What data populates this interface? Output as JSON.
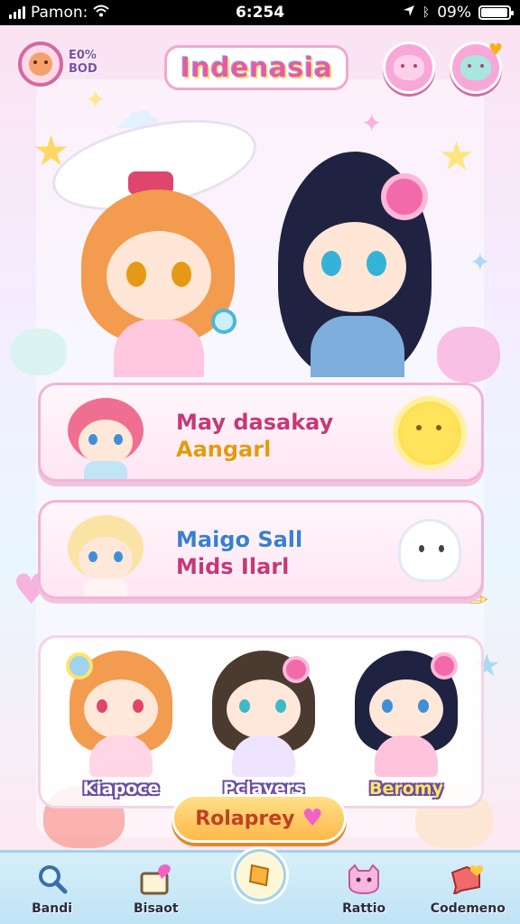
{
  "status_bar": {
    "carrier": "Pamon:",
    "time": "6:254",
    "battery_text": "09%",
    "battery_level": 0.9,
    "icons": [
      "signal-icon",
      "wifi-icon",
      "location-icon",
      "bluetooth-icon",
      "battery-icon"
    ]
  },
  "header": {
    "title": "Indenasia",
    "stats_line1": "E0%",
    "stats_line2": "BOD",
    "left_icon": "profile-avatar",
    "right_icons": [
      "chat-mascot-icon",
      "gift-heart-icon"
    ]
  },
  "cards": [
    {
      "title": "May dasakay",
      "subtitle": "Aangarl",
      "mascot": "sun-icon"
    },
    {
      "title": "Maigo Sall",
      "subtitle": "Mids Ilarl",
      "mascot": "ghost-cat-icon"
    }
  ],
  "characters": [
    {
      "name": "Kiapoce",
      "hair": "#f39b4e",
      "eye": "#e2456a",
      "outfit": "#ffd6e6"
    },
    {
      "name": "Pclavers",
      "hair": "#4a3a30",
      "eye": "#3fb8c8",
      "outfit": "#efe4ff"
    },
    {
      "name": "Beromy",
      "hair": "#1f2240",
      "eye": "#3f8fd8",
      "outfit": "#ffc3dc"
    }
  ],
  "action_button": {
    "label": "Rolaprey",
    "icon": "heart-icon"
  },
  "bottom_nav": [
    {
      "label": "Bandi",
      "icon": "magnifier-icon",
      "active": false
    },
    {
      "label": "Bisaot",
      "icon": "gift-box-icon",
      "active": false
    },
    {
      "label": "",
      "icon": "home-icon",
      "active": true
    },
    {
      "label": "Rattio",
      "icon": "cat-face-icon",
      "active": false
    },
    {
      "label": "Codemeno",
      "icon": "chat-heart-icon",
      "active": false
    }
  ],
  "colors": {
    "accent_pink": "#e85aa6",
    "accent_orange": "#ffb84a",
    "nav_blue": "#bfe3f5"
  }
}
